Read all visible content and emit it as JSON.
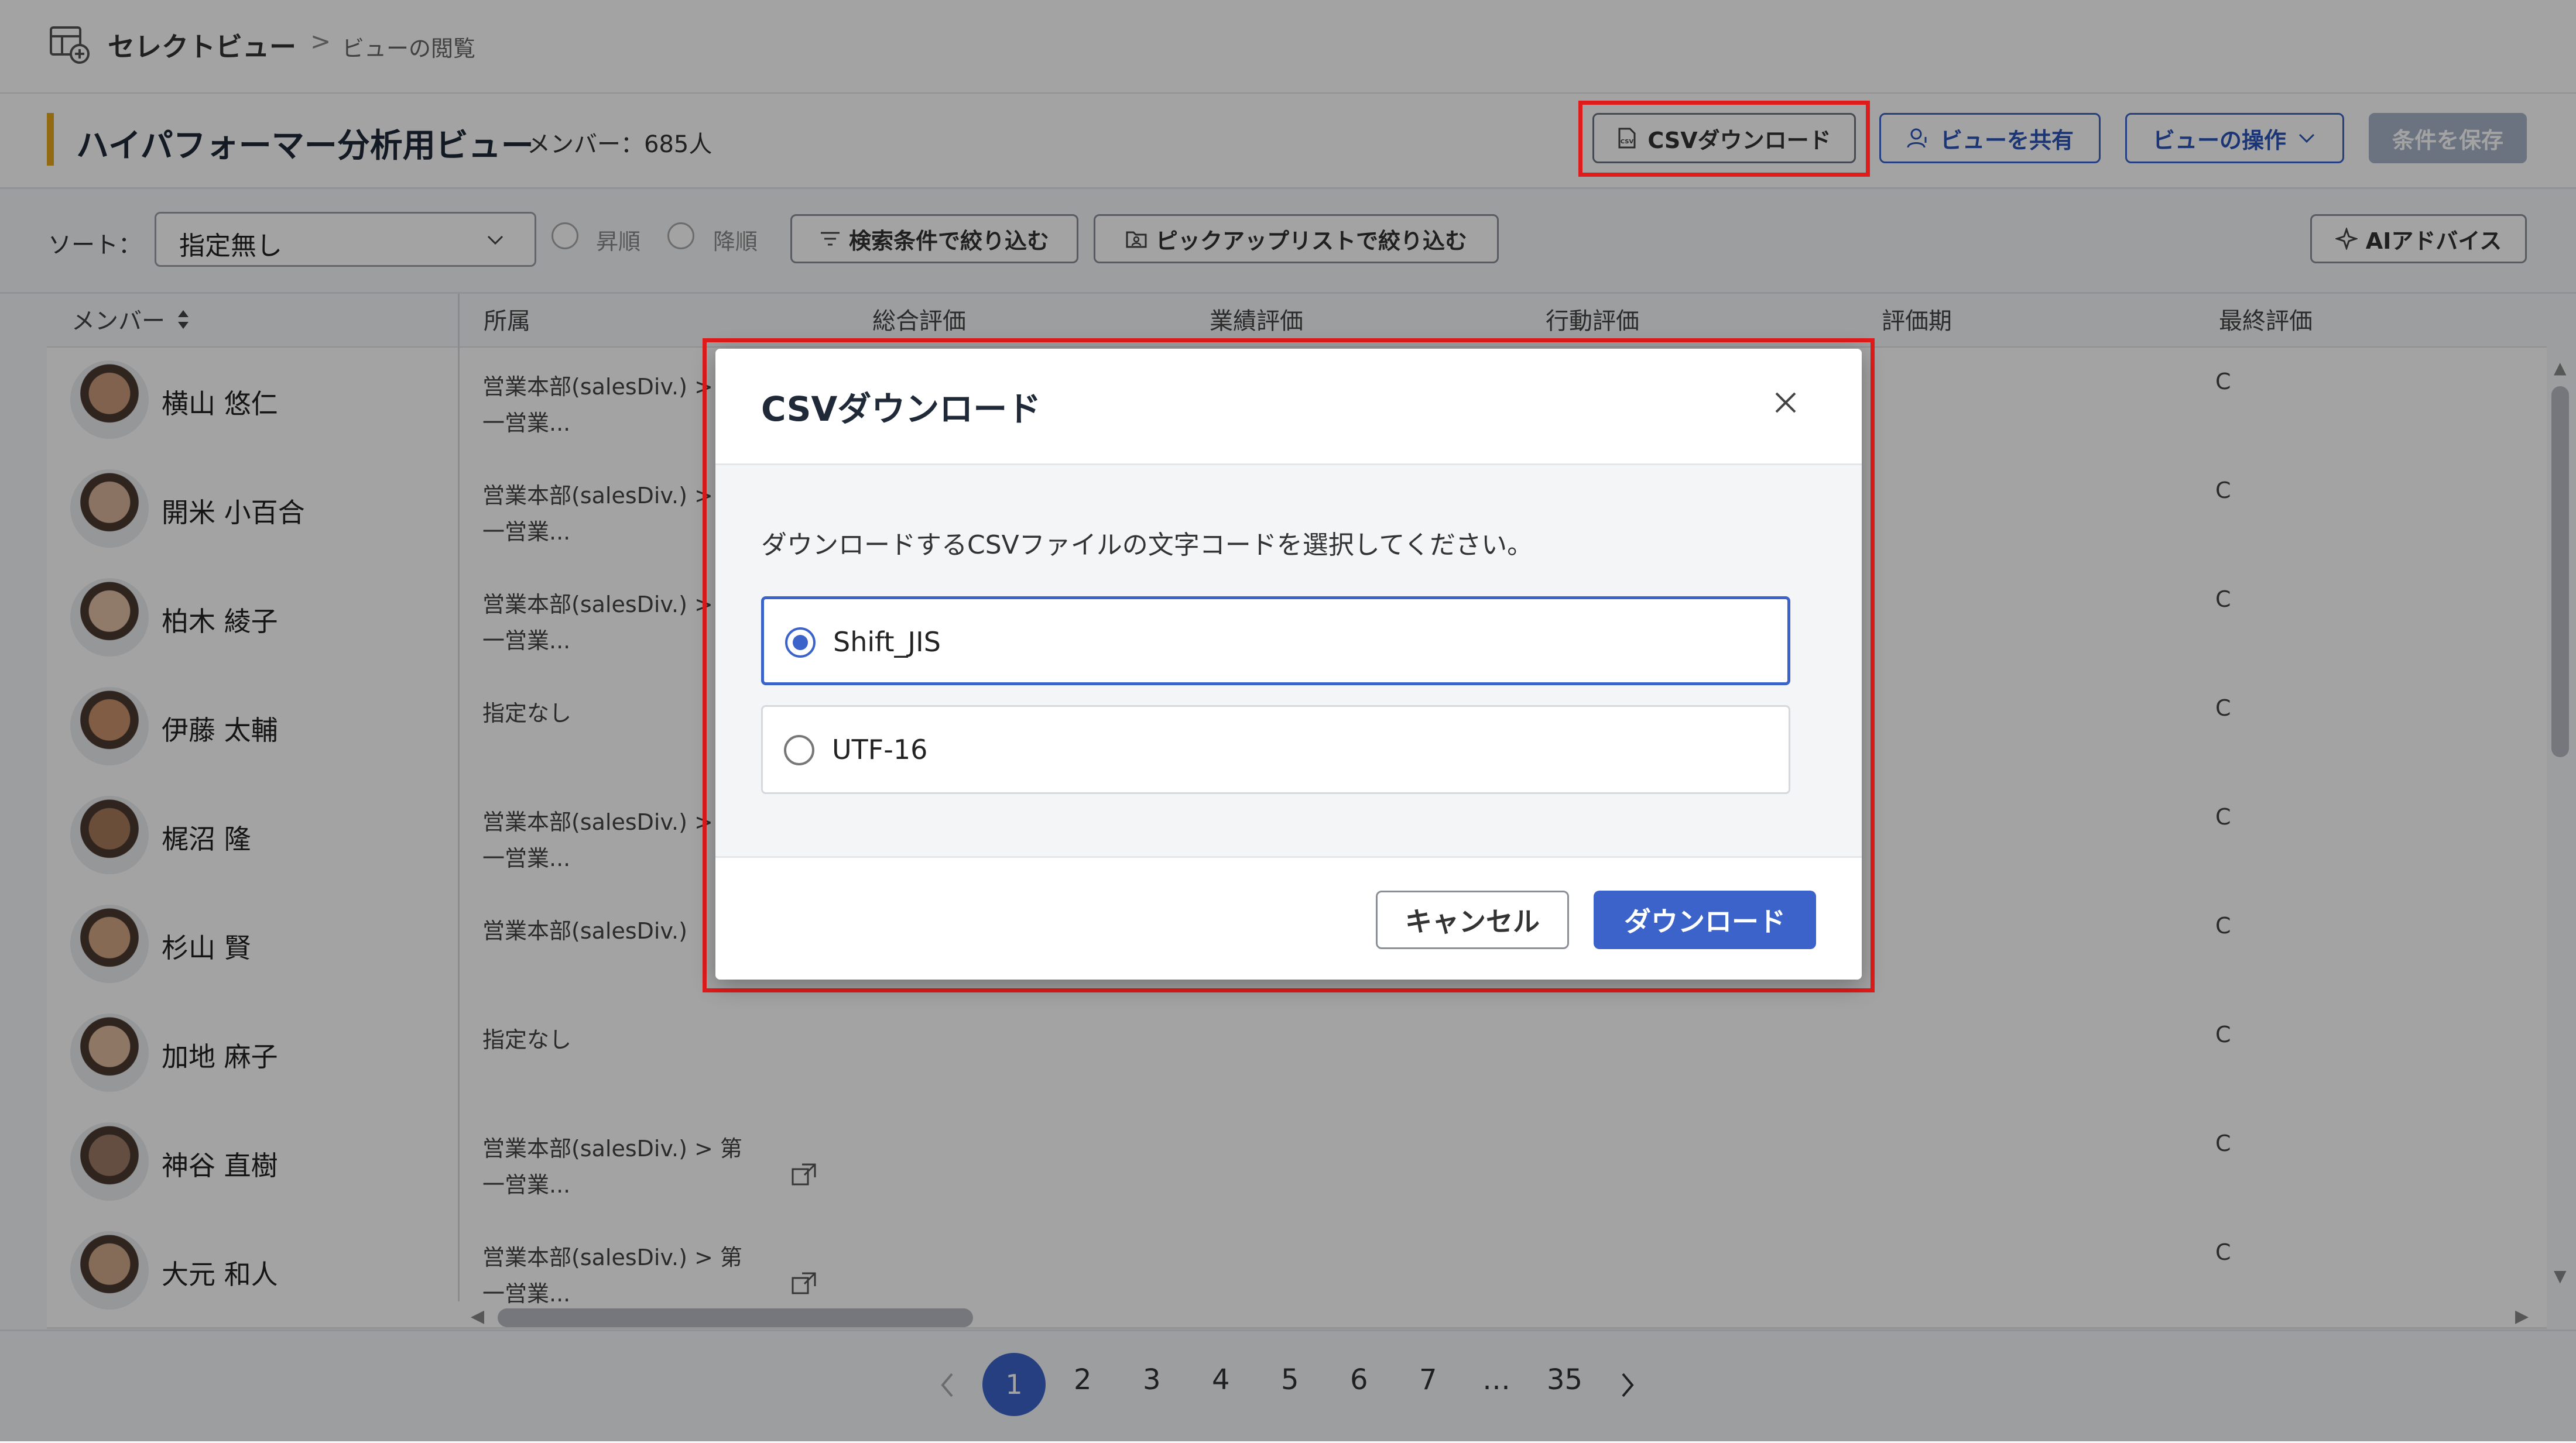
{
  "breadcrumb": {
    "root": "セレクトビュー",
    "separator": ">",
    "current": "ビューの閲覧"
  },
  "header": {
    "title": "ハイパフォーマー分析用ビュー",
    "member_count": "メンバー：685人",
    "csv_button": "CSVダウンロード",
    "share_button": "ビューを共有",
    "ops_button": "ビューの操作",
    "save_button": "条件を保存"
  },
  "filters": {
    "sort_label": "ソート：",
    "sort_value": "指定無し",
    "asc_label": "昇順",
    "desc_label": "降順",
    "search_filter_button": "検索条件で絞り込む",
    "pick_filter_button": "ピックアップリストで絞り込む",
    "ai_button": "AIアドバイス"
  },
  "table": {
    "columns": [
      "メンバー",
      "所属",
      "総合評価",
      "業績評価",
      "行動評価",
      "評価期",
      "最終評価"
    ],
    "rows": [
      {
        "name": "横山 悠仁",
        "dept": "営業本部(salesDiv.) > 第一営業...",
        "final": "C",
        "avatar_color": "#c99a7a"
      },
      {
        "name": "開米 小百合",
        "dept": "営業本部(salesDiv.) > 第一営業...",
        "final": "C",
        "avatar_color": "#d8b59c"
      },
      {
        "name": "柏木 綾子",
        "dept": "営業本部(salesDiv.) > 第一営業...",
        "final": "C",
        "avatar_color": "#e2bfa6"
      },
      {
        "name": "伊藤 太輔",
        "dept": "指定なし",
        "final": "C",
        "avatar_color": "#c8926b"
      },
      {
        "name": "梶沼 隆",
        "dept": "営業本部(salesDiv.) > 第一営業...",
        "final": "C",
        "avatar_color": "#a87a5c"
      },
      {
        "name": "杉山 賢",
        "dept": "営業本部(salesDiv.)",
        "final": "C",
        "avatar_color": "#d3a784"
      },
      {
        "name": "加地 麻子",
        "dept": "指定なし",
        "final": "C",
        "avatar_color": "#e0bba0"
      },
      {
        "name": "神谷 直樹",
        "dept": "営業本部(salesDiv.) > 第一営業...",
        "final": "C",
        "avatar_color": "#9c7a66"
      },
      {
        "name": "大元 和人",
        "dept": "営業本部(salesDiv.) > 第一営業...",
        "final": "C",
        "avatar_color": "#d1a98a"
      }
    ]
  },
  "pagination": {
    "pages": [
      "1",
      "2",
      "3",
      "4",
      "5",
      "6",
      "7",
      "…",
      "35"
    ],
    "current": "1"
  },
  "modal": {
    "title": "CSVダウンロード",
    "description": "ダウンロードするCSVファイルの文字コードを選択してください。",
    "options": [
      {
        "label": "Shift_JIS",
        "selected": true
      },
      {
        "label": "UTF-16",
        "selected": false
      }
    ],
    "cancel_button": "キャンセル",
    "download_button": "ダウンロード"
  },
  "colors": {
    "accent": "#3b63c9",
    "highlight": "#e01b1b",
    "title_bar": "#e3a71d"
  }
}
